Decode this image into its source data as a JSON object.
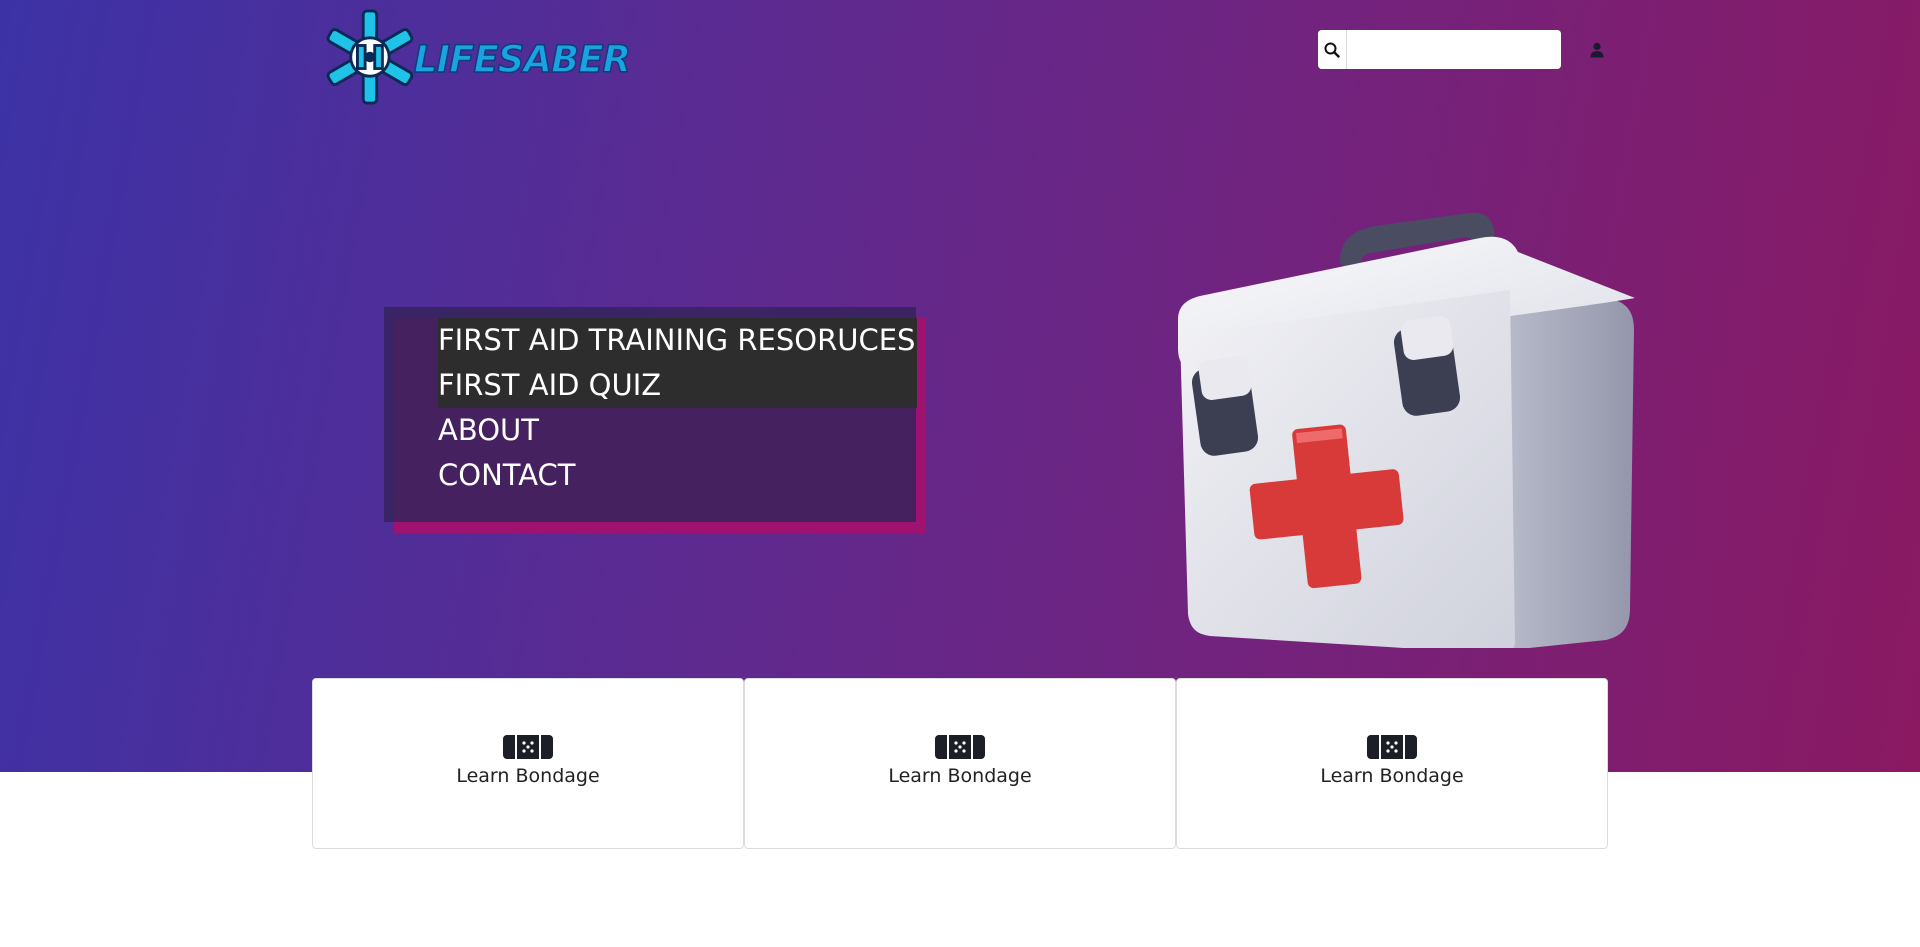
{
  "brand": {
    "name": "LIFESABER",
    "logo_icon": "snowflake-cross-logo",
    "text_color": "#1aa3e0"
  },
  "header": {
    "search": {
      "icon": "search-icon",
      "value": "",
      "placeholder": ""
    },
    "user_icon": "user-icon"
  },
  "hero": {
    "gradient": [
      "#3c32a6",
      "#8a1962"
    ],
    "image_icon": "first-aid-kit-icon"
  },
  "nav": {
    "items": [
      {
        "label": "FIRST AID TRAINING RESORUCES",
        "highlighted": true
      },
      {
        "label": "FIRST AID QUIZ",
        "highlighted": true
      },
      {
        "label": "ABOUT",
        "highlighted": false
      },
      {
        "label": "CONTACT",
        "highlighted": false
      }
    ],
    "shadow_color": "#a0126f",
    "highlight_color": "#2d2d2d"
  },
  "cards": [
    {
      "icon": "bandage-icon",
      "label": "Learn Bondage"
    },
    {
      "icon": "bandage-icon",
      "label": "Learn Bondage"
    },
    {
      "icon": "bandage-icon",
      "label": "Learn Bondage"
    }
  ]
}
